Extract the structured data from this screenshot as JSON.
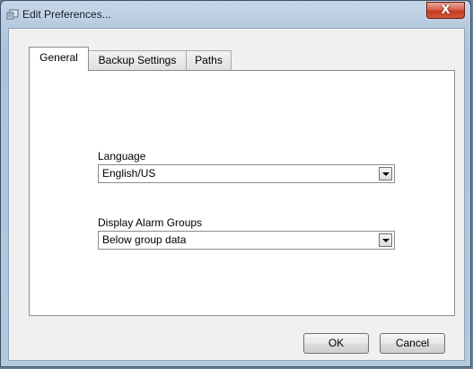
{
  "window": {
    "title": "Edit Preferences...",
    "close_label": "X"
  },
  "tabs": [
    {
      "label": "General",
      "active": true
    },
    {
      "label": "Backup Settings",
      "active": false
    },
    {
      "label": "Paths",
      "active": false
    }
  ],
  "general": {
    "language": {
      "label": "Language",
      "value": "English/US"
    },
    "alarm_groups": {
      "label": "Display Alarm Groups",
      "value": "Below group data"
    }
  },
  "buttons": {
    "ok": "OK",
    "cancel": "Cancel"
  },
  "colors": {
    "accent": "#c53a20",
    "window_frame": "#b6c9de"
  }
}
